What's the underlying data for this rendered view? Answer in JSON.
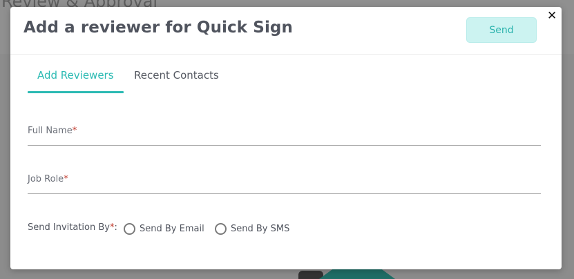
{
  "background": {
    "title": "Review & Approval"
  },
  "modal": {
    "title": "Add a reviewer for Quick Sign",
    "send_label": "Send",
    "close_glyph": "✕",
    "tabs": [
      {
        "label": "Add Reviewers",
        "active": true
      },
      {
        "label": "Recent Contacts",
        "active": false
      }
    ],
    "fields": {
      "full_name": {
        "label": "Full Name",
        "required_mark": "*",
        "value": ""
      },
      "job_role": {
        "label": "Job Role",
        "required_mark": "*",
        "value": ""
      }
    },
    "invitation": {
      "label": "Send Invitation By",
      "required_mark": "*",
      "suffix": ":",
      "options": [
        {
          "label": "Send By Email",
          "selected": false
        },
        {
          "label": "Send By SMS",
          "selected": false
        }
      ]
    }
  },
  "colors": {
    "accent": "#2bbab3",
    "send_button_bg": "#ccf3f1",
    "required": "#c0392b",
    "title_text": "#50545e"
  },
  "icons": {
    "close": "close-icon",
    "radio": "radio-icon"
  }
}
